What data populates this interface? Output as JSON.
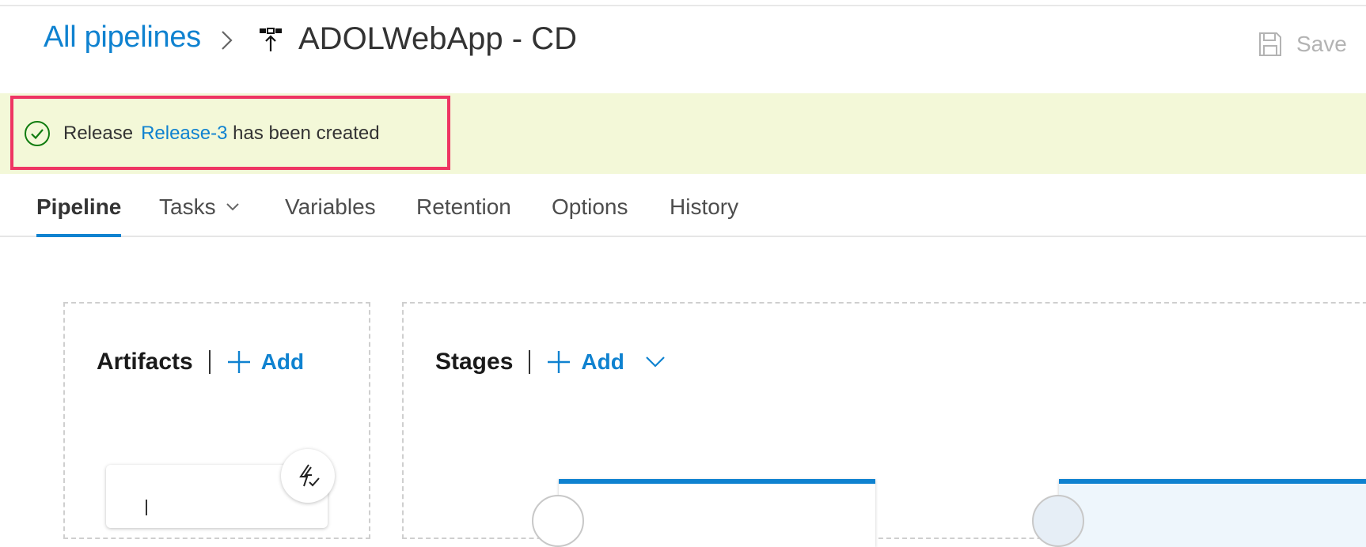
{
  "header": {
    "breadcrumb_link": "All pipelines",
    "pipeline_title": "ADOLWebApp - CD",
    "save_label": "Save",
    "icons": {
      "breadcrumb_separator": "chevron-right-icon",
      "pipeline": "release-pipeline-icon",
      "save": "floppy-disk-icon"
    }
  },
  "notification": {
    "prefix": "Release",
    "link_text": "Release-3",
    "suffix": "has been created",
    "icon": "check-circle-icon",
    "colors": {
      "background": "#f3f8d8",
      "highlight_border": "#ee3563",
      "success": "#107c10",
      "link": "#0f82d0"
    }
  },
  "tabs": {
    "items": [
      {
        "label": "Pipeline",
        "active": true
      },
      {
        "label": "Tasks",
        "has_dropdown": true
      },
      {
        "label": "Variables"
      },
      {
        "label": "Retention"
      },
      {
        "label": "Options"
      },
      {
        "label": "History"
      }
    ],
    "accent": "#0f82d0"
  },
  "artifacts": {
    "title": "Artifacts",
    "add_label": "Add",
    "trigger_icon": "continuous-deployment-trigger-icon"
  },
  "stages": {
    "title": "Stages",
    "add_label": "Add",
    "add_icon": "plus-icon",
    "dropdown_icon": "chevron-down-icon"
  }
}
